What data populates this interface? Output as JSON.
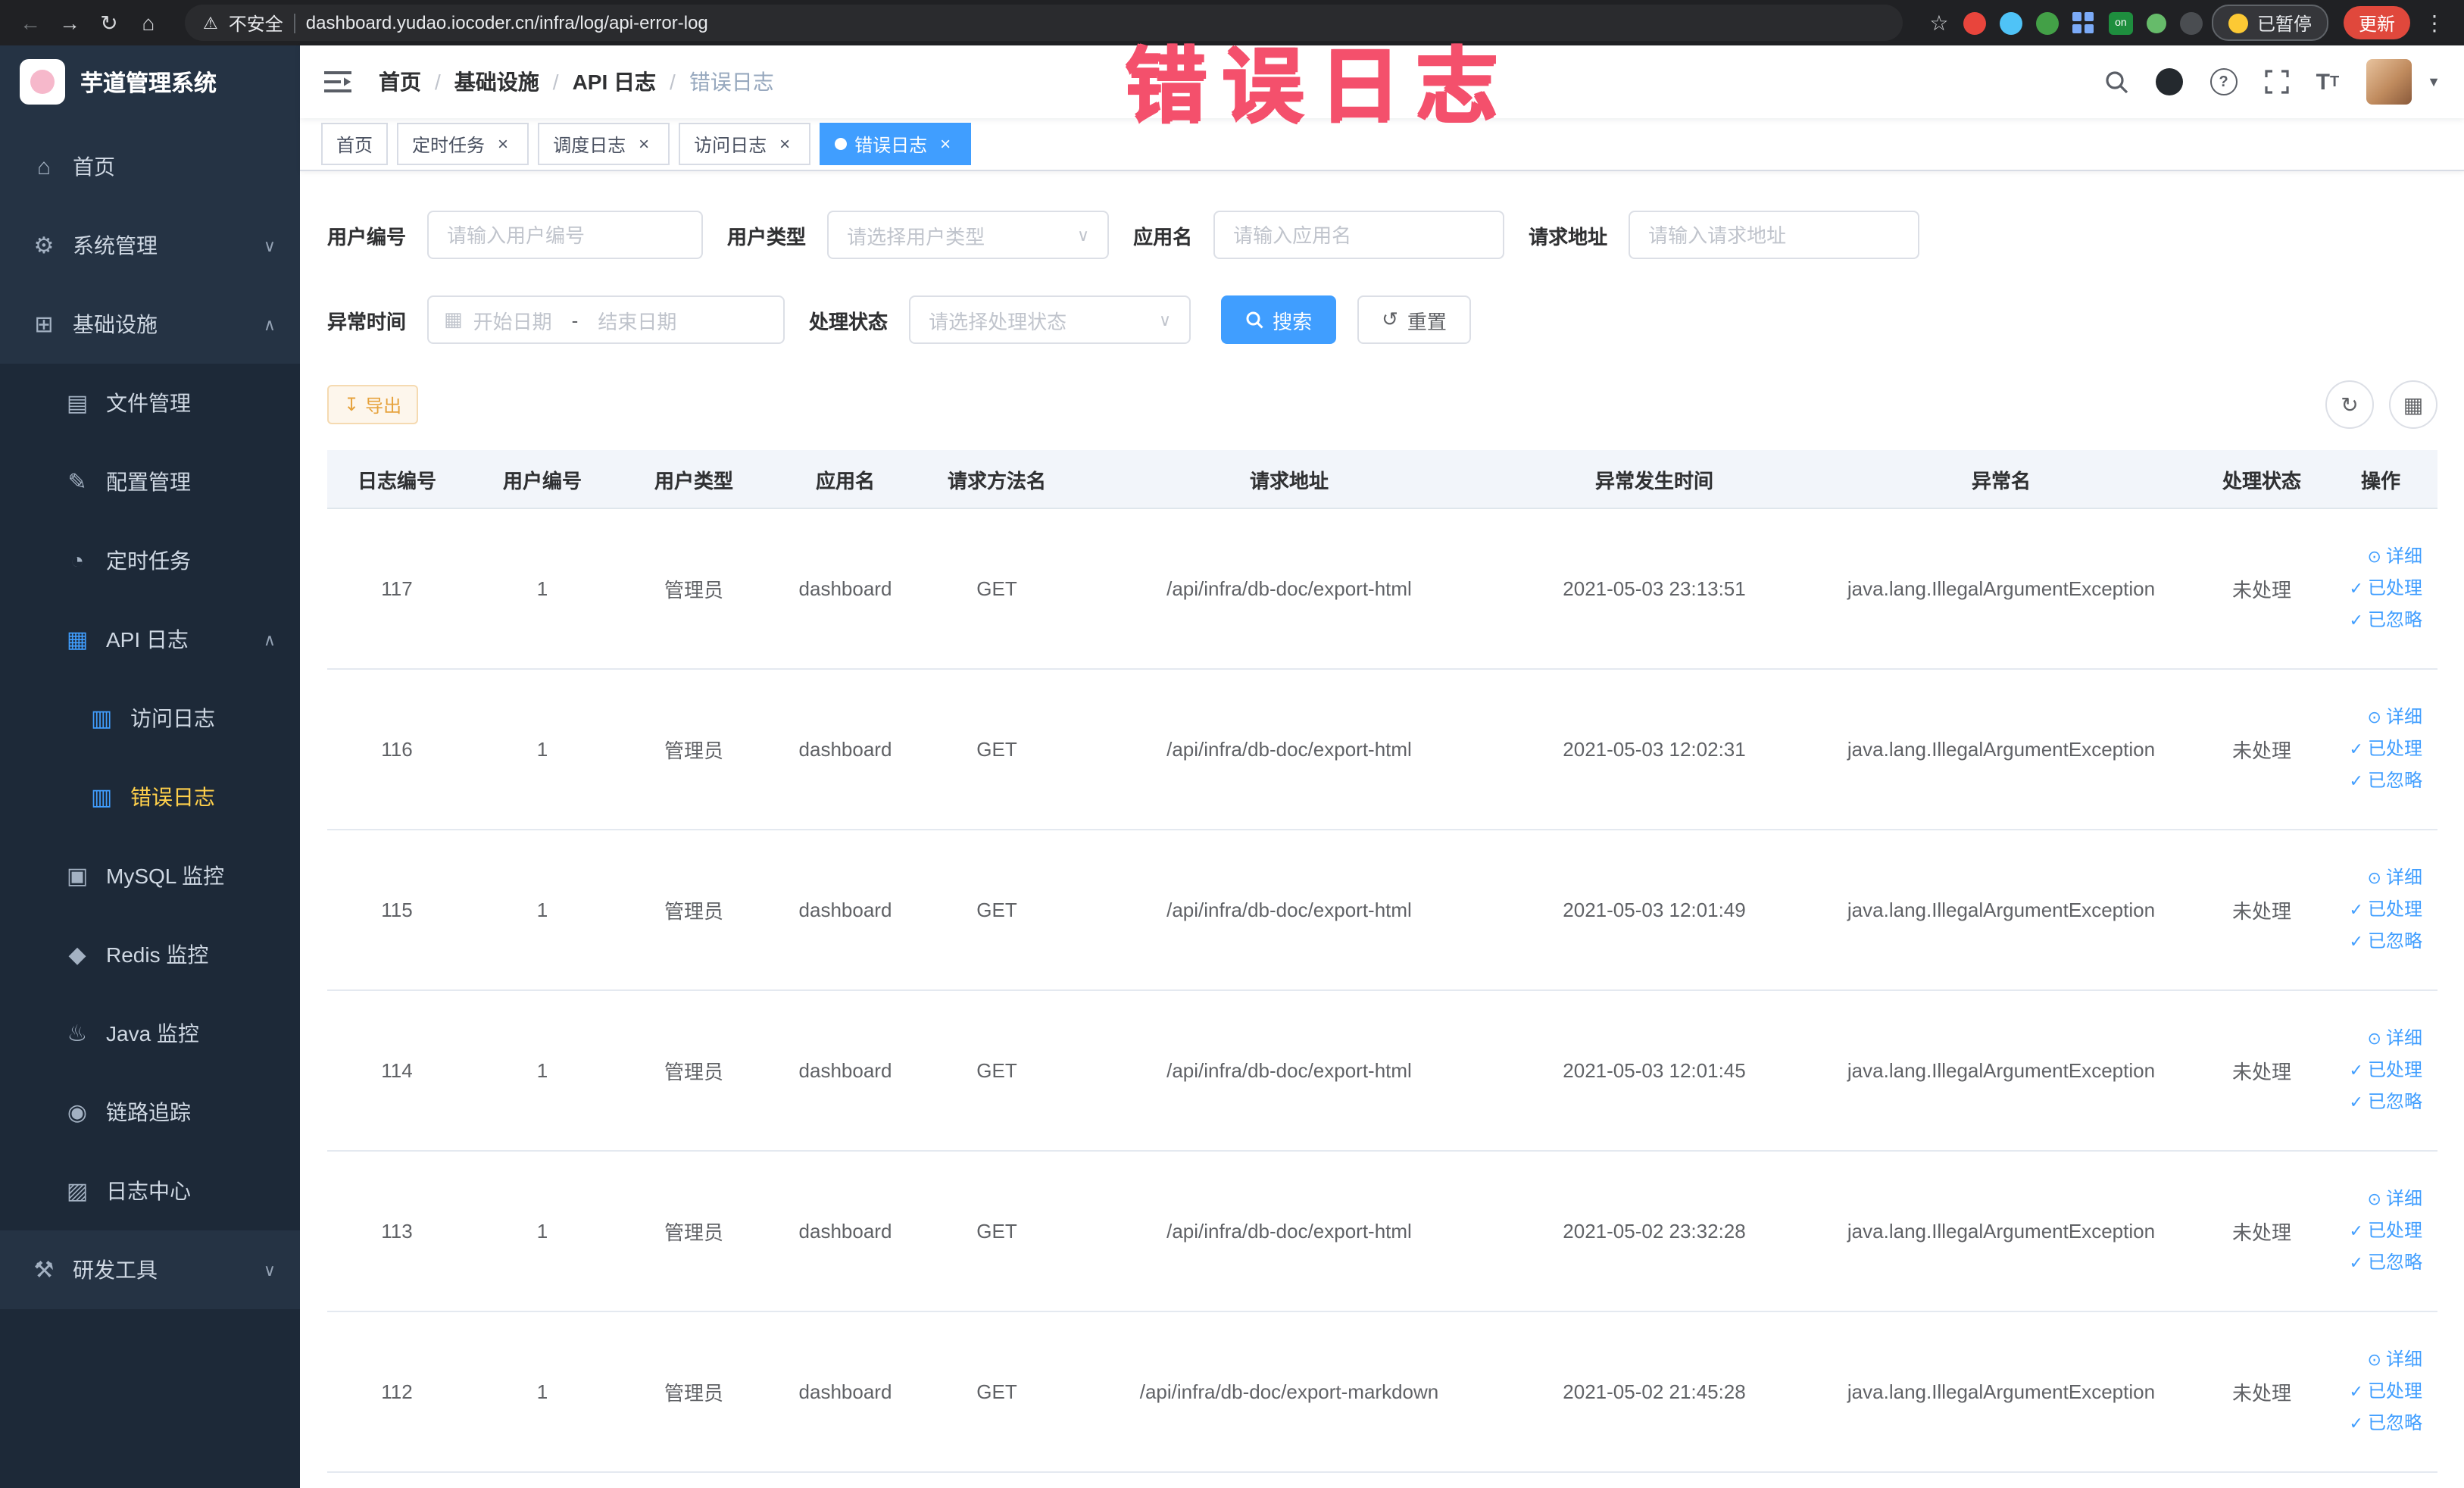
{
  "browser": {
    "security_label": "不安全",
    "url": "dashboard.yudao.iocoder.cn/infra/log/api-error-log",
    "extension_on_badge": "on",
    "paused_label": "已暂停",
    "update_label": "更新"
  },
  "annotation": "错误日志",
  "sidebar": {
    "logo_title": "芋道管理系统",
    "items": [
      {
        "label": "首页"
      },
      {
        "label": "系统管理"
      },
      {
        "label": "基础设施"
      },
      {
        "label": "文件管理"
      },
      {
        "label": "配置管理"
      },
      {
        "label": "定时任务"
      },
      {
        "label": "API 日志"
      },
      {
        "label": "访问日志"
      },
      {
        "label": "错误日志"
      },
      {
        "label": "MySQL 监控"
      },
      {
        "label": "Redis 监控"
      },
      {
        "label": "Java 监控"
      },
      {
        "label": "链路追踪"
      },
      {
        "label": "日志中心"
      },
      {
        "label": "研发工具"
      }
    ]
  },
  "header": {
    "breadcrumb": [
      "首页",
      "基础设施",
      "API 日志",
      "错误日志"
    ]
  },
  "tabs": [
    {
      "label": "首页"
    },
    {
      "label": "定时任务"
    },
    {
      "label": "调度日志"
    },
    {
      "label": "访问日志"
    },
    {
      "label": "错误日志"
    }
  ],
  "filters": {
    "user_id": {
      "label": "用户编号",
      "placeholder": "请输入用户编号"
    },
    "user_type": {
      "label": "用户类型",
      "placeholder": "请选择用户类型"
    },
    "app_name": {
      "label": "应用名",
      "placeholder": "请输入应用名"
    },
    "request_url": {
      "label": "请求地址",
      "placeholder": "请输入请求地址"
    },
    "exception_time": {
      "label": "异常时间",
      "start_placeholder": "开始日期",
      "separator": "-",
      "end_placeholder": "结束日期"
    },
    "process_status": {
      "label": "处理状态",
      "placeholder": "请选择处理状态"
    },
    "search_button": "搜索",
    "reset_button": "重置"
  },
  "toolbar": {
    "export_button": "导出"
  },
  "table": {
    "columns": [
      "日志编号",
      "用户编号",
      "用户类型",
      "应用名",
      "请求方法名",
      "请求地址",
      "异常发生时间",
      "异常名",
      "处理状态",
      "操作"
    ],
    "actions": [
      "详细",
      "已处理",
      "已忽略"
    ],
    "rows": [
      {
        "id": "117",
        "user_id": "1",
        "user_type": "管理员",
        "app": "dashboard",
        "method": "GET",
        "url": "/api/infra/db-doc/export-html",
        "time": "2021-05-03 23:13:51",
        "exception": "java.lang.IllegalArgumentException",
        "status": "未处理"
      },
      {
        "id": "116",
        "user_id": "1",
        "user_type": "管理员",
        "app": "dashboard",
        "method": "GET",
        "url": "/api/infra/db-doc/export-html",
        "time": "2021-05-03 12:02:31",
        "exception": "java.lang.IllegalArgumentException",
        "status": "未处理"
      },
      {
        "id": "115",
        "user_id": "1",
        "user_type": "管理员",
        "app": "dashboard",
        "method": "GET",
        "url": "/api/infra/db-doc/export-html",
        "time": "2021-05-03 12:01:49",
        "exception": "java.lang.IllegalArgumentException",
        "status": "未处理"
      },
      {
        "id": "114",
        "user_id": "1",
        "user_type": "管理员",
        "app": "dashboard",
        "method": "GET",
        "url": "/api/infra/db-doc/export-html",
        "time": "2021-05-03 12:01:45",
        "exception": "java.lang.IllegalArgumentException",
        "status": "未处理"
      },
      {
        "id": "113",
        "user_id": "1",
        "user_type": "管理员",
        "app": "dashboard",
        "method": "GET",
        "url": "/api/infra/db-doc/export-html",
        "time": "2021-05-02 23:32:28",
        "exception": "java.lang.IllegalArgumentException",
        "status": "未处理"
      },
      {
        "id": "112",
        "user_id": "1",
        "user_type": "管理员",
        "app": "dashboard",
        "method": "GET",
        "url": "/api/infra/db-doc/export-markdown",
        "time": "2021-05-02 21:45:28",
        "exception": "java.lang.IllegalArgumentException",
        "status": "未处理"
      }
    ]
  }
}
